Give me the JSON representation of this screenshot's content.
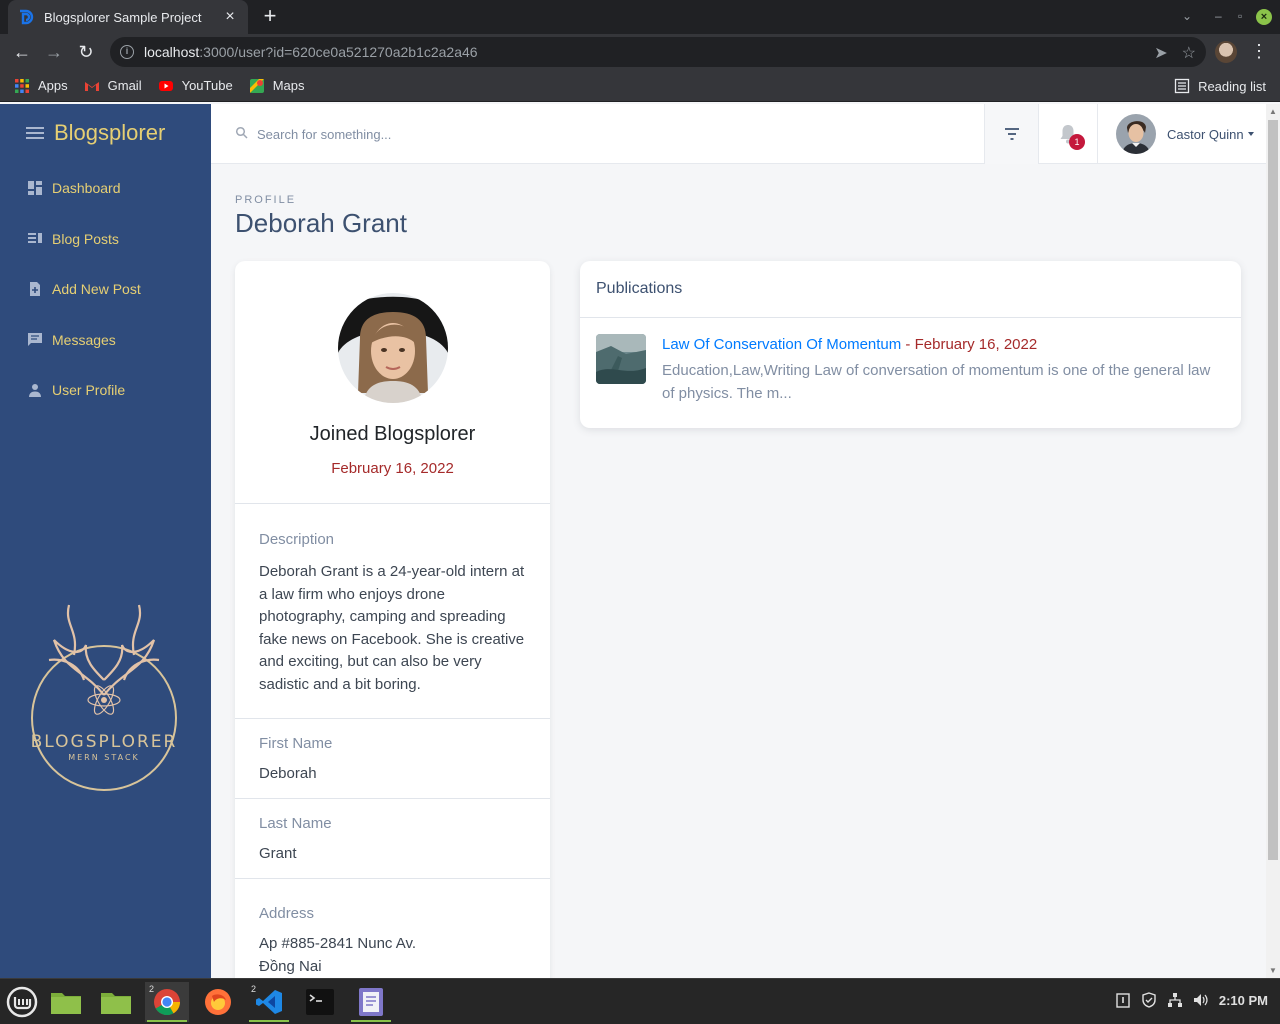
{
  "browser": {
    "tab_title": "Blogsplorer Sample Project",
    "url_host": "localhost",
    "url_rest": ":3000/user?id=620ce0a521270a2b1c2a2a46",
    "bookmarks": [
      {
        "label": "Apps",
        "icon": "apps-grid-icon"
      },
      {
        "label": "Gmail",
        "icon": "gmail-icon"
      },
      {
        "label": "YouTube",
        "icon": "youtube-icon"
      },
      {
        "label": "Maps",
        "icon": "maps-icon"
      }
    ],
    "reading_list": "Reading list"
  },
  "sidebar": {
    "brand": "Blogsplorer",
    "items": [
      {
        "label": "Dashboard",
        "icon": "dashboard-icon"
      },
      {
        "label": "Blog Posts",
        "icon": "blog-posts-icon"
      },
      {
        "label": "Add New Post",
        "icon": "add-post-icon"
      },
      {
        "label": "Messages",
        "icon": "messages-icon"
      },
      {
        "label": "User Profile",
        "icon": "person-icon"
      }
    ],
    "logo_text": "BLOGSPLORER",
    "logo_subtext": "MERN STACK"
  },
  "header": {
    "search_placeholder": "Search for something...",
    "notifications_count": "1",
    "user_name": "Castor Quinn"
  },
  "page": {
    "subtitle": "PROFILE",
    "title": "Deborah Grant"
  },
  "profile": {
    "joined_label": "Joined Blogsplorer",
    "joined_date": "February 16, 2022",
    "description_label": "Description",
    "description": "Deborah Grant is a 24-year-old intern at a law firm who enjoys drone photography, camping and spreading fake news on Facebook. She is creative and exciting, but can also be very sadistic and a bit boring.",
    "first_name_label": "First Name",
    "first_name": "Deborah",
    "last_name_label": "Last Name",
    "last_name": "Grant",
    "address_label": "Address",
    "address_line1": "Ap #885-2841 Nunc Av.",
    "address_line2": "Đồng Nai"
  },
  "publications": {
    "title": "Publications",
    "items": [
      {
        "title": "Law Of Conservation Of Momentum",
        "separator": " - ",
        "date": "February 16, 2022",
        "excerpt": "Education,Law,Writing Law of conversation of momentum is one of the general law of physics. The m..."
      }
    ]
  },
  "taskbar": {
    "chrome_count": "2",
    "vscode_count": "2",
    "clock": "2:10 PM"
  },
  "colors": {
    "sidebar_bg": "#2f4b7c",
    "sidebar_text": "#e6cf73",
    "link": "#007bff",
    "date_red": "#a52a2a",
    "badge": "#c4183c"
  }
}
